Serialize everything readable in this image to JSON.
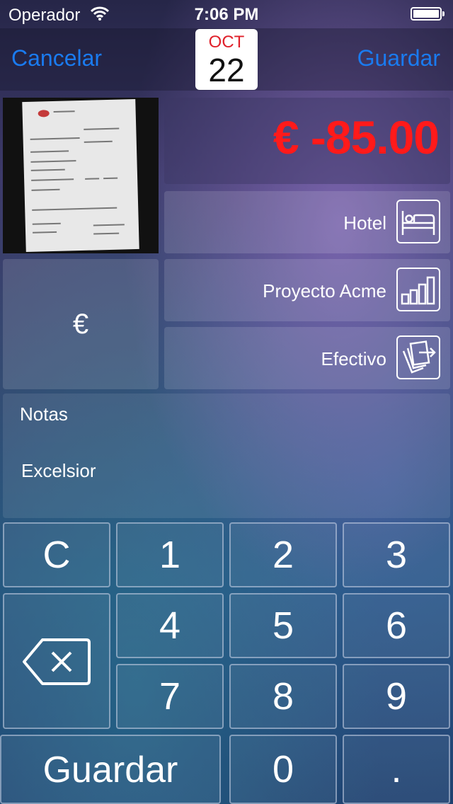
{
  "status": {
    "carrier": "Operador",
    "time": "7:06 PM"
  },
  "nav": {
    "cancel": "Cancelar",
    "save": "Guardar",
    "date_month": "OCT",
    "date_day": "22"
  },
  "amount": "€ -85.00",
  "colors": {
    "accent": "#1a7bf0",
    "amount": "#ff1a1a",
    "date_month": "#e0202a"
  },
  "category": {
    "label": "Hotel",
    "icon": "bed-icon"
  },
  "project": {
    "label": "Proyecto Acme",
    "icon": "bar-chart-icon"
  },
  "payment": {
    "label": "Efectivo",
    "icon": "cash-transfer-icon"
  },
  "currency": "€",
  "notes": {
    "label": "Notas",
    "value": "Excelsior"
  },
  "keypad": {
    "clear": "C",
    "k1": "1",
    "k2": "2",
    "k3": "3",
    "k4": "4",
    "k5": "5",
    "k6": "6",
    "k7": "7",
    "k8": "8",
    "k9": "9",
    "k0": "0",
    "dot": ".",
    "save": "Guardar"
  }
}
